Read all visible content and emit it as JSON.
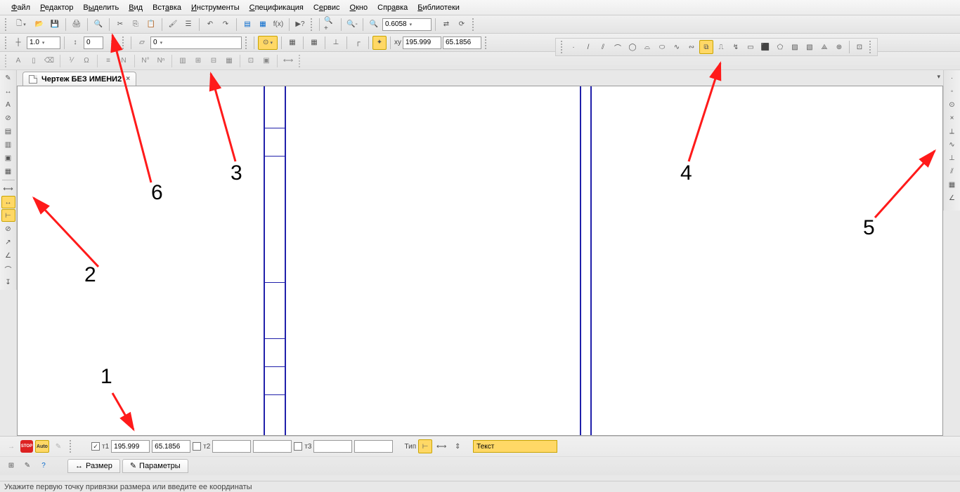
{
  "menu": [
    "Файл",
    "Редактор",
    "Выделить",
    "Вид",
    "Вставка",
    "Инструменты",
    "Спецификация",
    "Сервис",
    "Окно",
    "Справка",
    "Библиотеки"
  ],
  "toolbar1": {
    "zoom_value": "0.6058",
    "coord_x": "195.999",
    "coord_y": "65.1856"
  },
  "toolbar2": {
    "style_combo": "1.0",
    "num_input": "0",
    "layer_combo": "0"
  },
  "tab": {
    "title": "Чертеж БЕЗ ИМЕНИ2"
  },
  "annotations": {
    "n1": "1",
    "n2": "2",
    "n3": "3",
    "n4": "4",
    "n5": "5",
    "n6": "6"
  },
  "propbar": {
    "pt1_label": "т1",
    "pt1_x": "195.999",
    "pt1_y": "65.1856",
    "pt2_label": "т2",
    "pt3_label": "т3",
    "type_label": "Тип",
    "text_label": "Текст",
    "tab_size": "Размер",
    "tab_params": "Параметры",
    "stop": "STOP",
    "auto": "Auto"
  },
  "status": "Укажите первую точку привязки размера или введите ее координаты"
}
